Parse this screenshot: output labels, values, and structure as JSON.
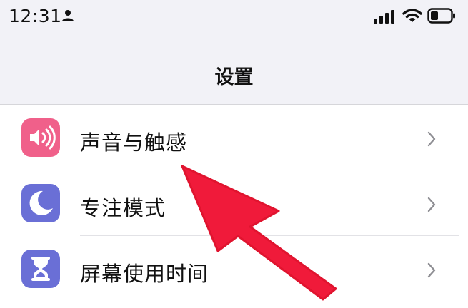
{
  "status_bar": {
    "time": "12:31",
    "icons": [
      "person-icon",
      "signal-icon",
      "wifi-icon",
      "battery-icon"
    ]
  },
  "nav": {
    "title": "设置"
  },
  "settings_items": [
    {
      "label": "声音与触感",
      "icon": "speaker-icon",
      "icon_color": "#f0608a"
    },
    {
      "label": "专注模式",
      "icon": "moon-icon",
      "icon_color": "#6a6fd6"
    },
    {
      "label": "屏幕使用时间",
      "icon": "hourglass-icon",
      "icon_color": "#6a6fd6"
    }
  ],
  "annotation": {
    "arrow_color": "#f01a3a"
  }
}
